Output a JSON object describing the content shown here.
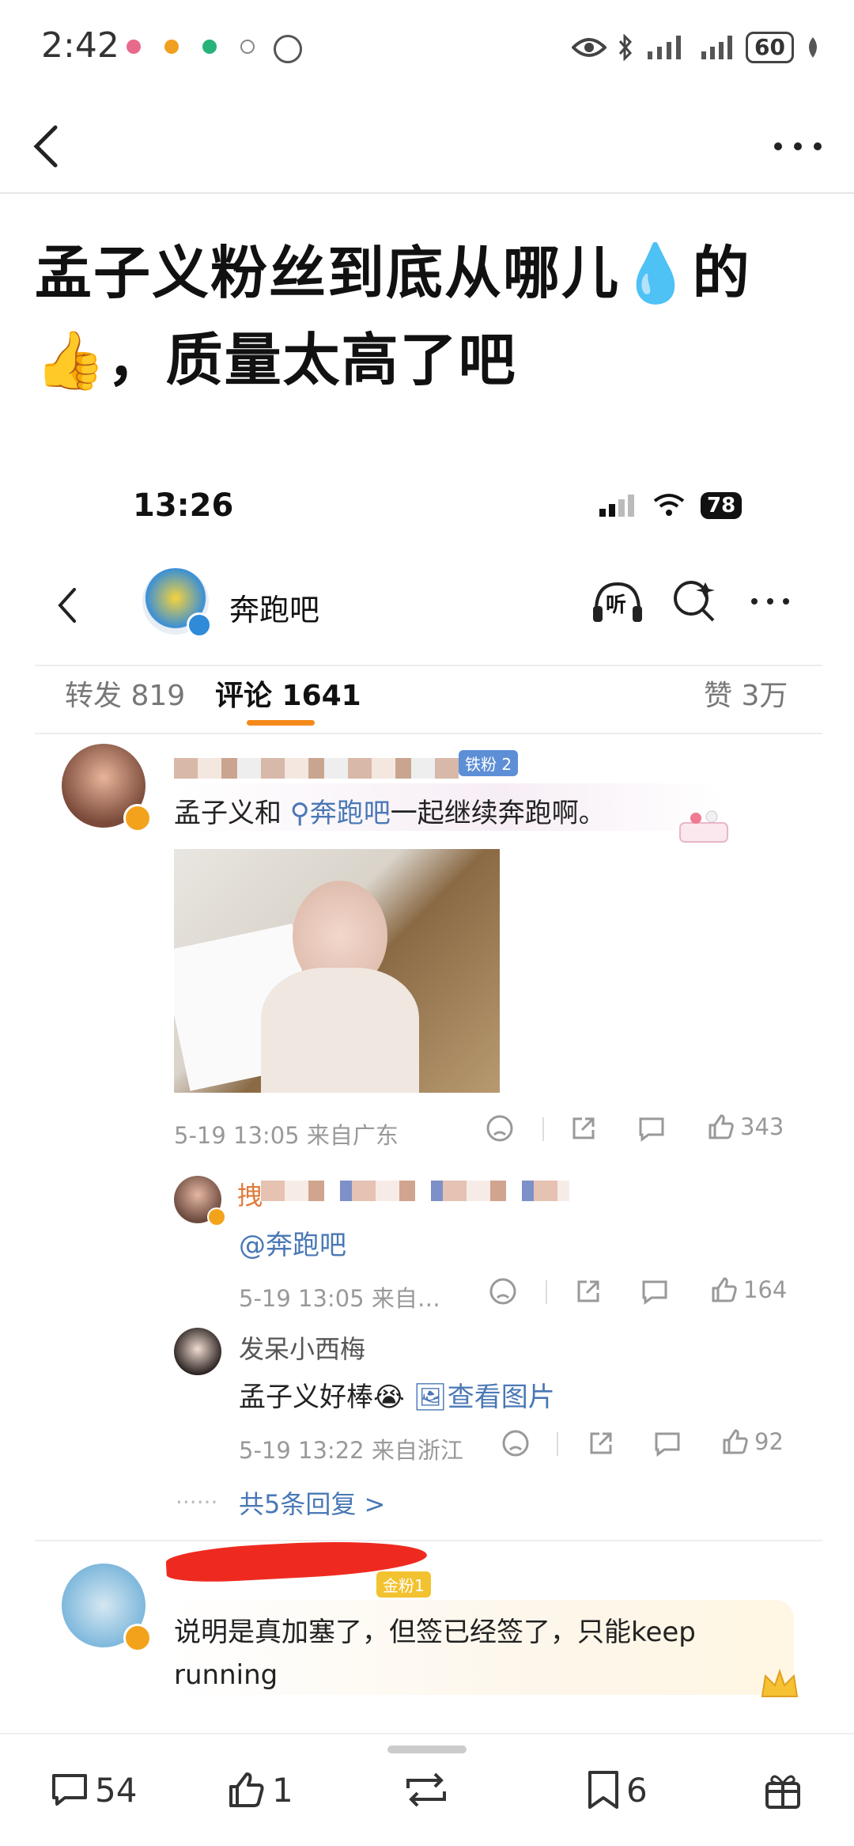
{
  "status": {
    "time": "2:42",
    "battery": "60"
  },
  "post": {
    "title": "孟子义粉丝到底从哪儿💧的👍，质量太高了吧"
  },
  "inner": {
    "time": "13:26",
    "battery": "78",
    "account": "奔跑吧",
    "listen_label": "听",
    "tabs": {
      "repost": "转发 819",
      "comment": "评论 1641",
      "likes": "赞 3万"
    },
    "comment1": {
      "badge": "铁粉 2",
      "text_before": "孟子义和",
      "mention": "奔跑吧",
      "text_after": "一起继续奔跑啊。",
      "meta": "5-19 13:05 来自广东",
      "likes": "343"
    },
    "reply1": {
      "name_visible": "拽",
      "text": "@奔跑吧",
      "meta": "5-19 13:05 来自…",
      "likes": "164"
    },
    "reply2": {
      "name": "发呆小西梅",
      "text": "孟子义好棒😭",
      "link": "查看图片",
      "meta": "5-19 13:22 来自浙江",
      "likes": "92"
    },
    "more_replies": "共5条回复 >",
    "comment2": {
      "badge": "金粉1",
      "text": "说明是真加塞了，但签已经签了，只能keep running"
    }
  },
  "bottom": {
    "comments": "54",
    "likes": "1",
    "bookmarks": "6"
  },
  "colors": {
    "accent": "#f48a1c",
    "link": "#4a78b5",
    "muted": "#999999"
  }
}
